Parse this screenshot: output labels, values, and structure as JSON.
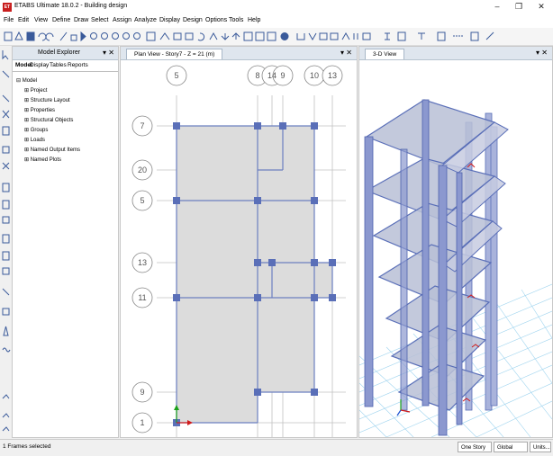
{
  "window": {
    "title": "ETABS Ultimate 18.0.2 - Building design",
    "app_icon_text": "ET",
    "minimize": "–",
    "restore": "❐",
    "close": "✕"
  },
  "menu": [
    "File",
    "Edit",
    "View",
    "Define",
    "Draw",
    "Select",
    "Assign",
    "Analyze",
    "Display",
    "Design",
    "Options",
    "Tools",
    "Help"
  ],
  "explorer": {
    "title": "Model Explorer",
    "pin": "▾ ✕",
    "tabs": [
      "Model",
      "Display",
      "Tables",
      "Reports"
    ],
    "tree": [
      {
        "label": "Model",
        "expander": "⊟",
        "indent": 0
      },
      {
        "label": "Project",
        "expander": "⊞",
        "indent": 1
      },
      {
        "label": "Structure Layout",
        "expander": "⊞",
        "indent": 1
      },
      {
        "label": "Properties",
        "expander": "⊞",
        "indent": 1
      },
      {
        "label": "Structural Objects",
        "expander": "⊞",
        "indent": 1
      },
      {
        "label": "Groups",
        "expander": "⊞",
        "indent": 1
      },
      {
        "label": "Loads",
        "expander": "⊞",
        "indent": 1
      },
      {
        "label": "Named Output Items",
        "expander": "⊞",
        "indent": 1
      },
      {
        "label": "Named Plots",
        "expander": "⊞",
        "indent": 1
      }
    ]
  },
  "plan_view": {
    "tab": "Plan View - Story7 - Z = 21 (m)",
    "ctrl": "▾ ✕",
    "col_bubbles": [
      "5",
      "8",
      "14",
      "9",
      "10",
      "13"
    ],
    "row_bubbles": [
      "7",
      "20",
      "5",
      "13",
      "11",
      "9",
      "1"
    ]
  },
  "view_3d": {
    "tab": "3-D View",
    "ctrl": "▾ ✕"
  },
  "status": {
    "text": "1 Frames selected",
    "story": "One Story",
    "coord": "Global",
    "units": "Units..."
  },
  "colors": {
    "frame": "#5a6fb8",
    "slab": "#d8d8d8",
    "grid": "#c0c0c0"
  }
}
